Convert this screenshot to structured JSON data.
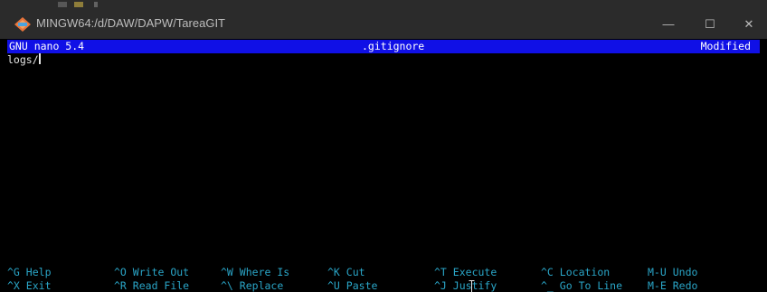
{
  "window": {
    "title": "MINGW64:/d/DAW/DAPW/TareaGIT",
    "controls": {
      "minimize": "—",
      "maximize": "☐",
      "close": "✕"
    }
  },
  "nano": {
    "version": "GNU nano 5.4",
    "filename": ".gitignore",
    "status": "Modified"
  },
  "editor": {
    "lines": [
      "logs/"
    ]
  },
  "shortcuts": {
    "row1": [
      {
        "key": "^G",
        "label": "Help"
      },
      {
        "key": "^O",
        "label": "Write Out"
      },
      {
        "key": "^W",
        "label": "Where Is"
      },
      {
        "key": "^K",
        "label": "Cut"
      },
      {
        "key": "^T",
        "label": "Execute"
      },
      {
        "key": "^C",
        "label": "Location"
      },
      {
        "key": "M-U",
        "label": "Undo"
      }
    ],
    "row2": [
      {
        "key": "^X",
        "label": "Exit"
      },
      {
        "key": "^R",
        "label": "Read File"
      },
      {
        "key": "^\\",
        "label": "Replace"
      },
      {
        "key": "^U",
        "label": "Paste"
      },
      {
        "key": "^J",
        "label": "Justify"
      },
      {
        "key": "^_",
        "label": "Go To Line"
      },
      {
        "key": "M-E",
        "label": "Redo"
      }
    ]
  },
  "colors": {
    "titlebar": "#2b2b2b",
    "header_bg": "#1010e6",
    "shortcut_text": "#2aa6c8",
    "terminal_bg": "#000000"
  },
  "icons": {
    "app": "git-bash-icon",
    "mouse": "text-cursor-icon"
  }
}
